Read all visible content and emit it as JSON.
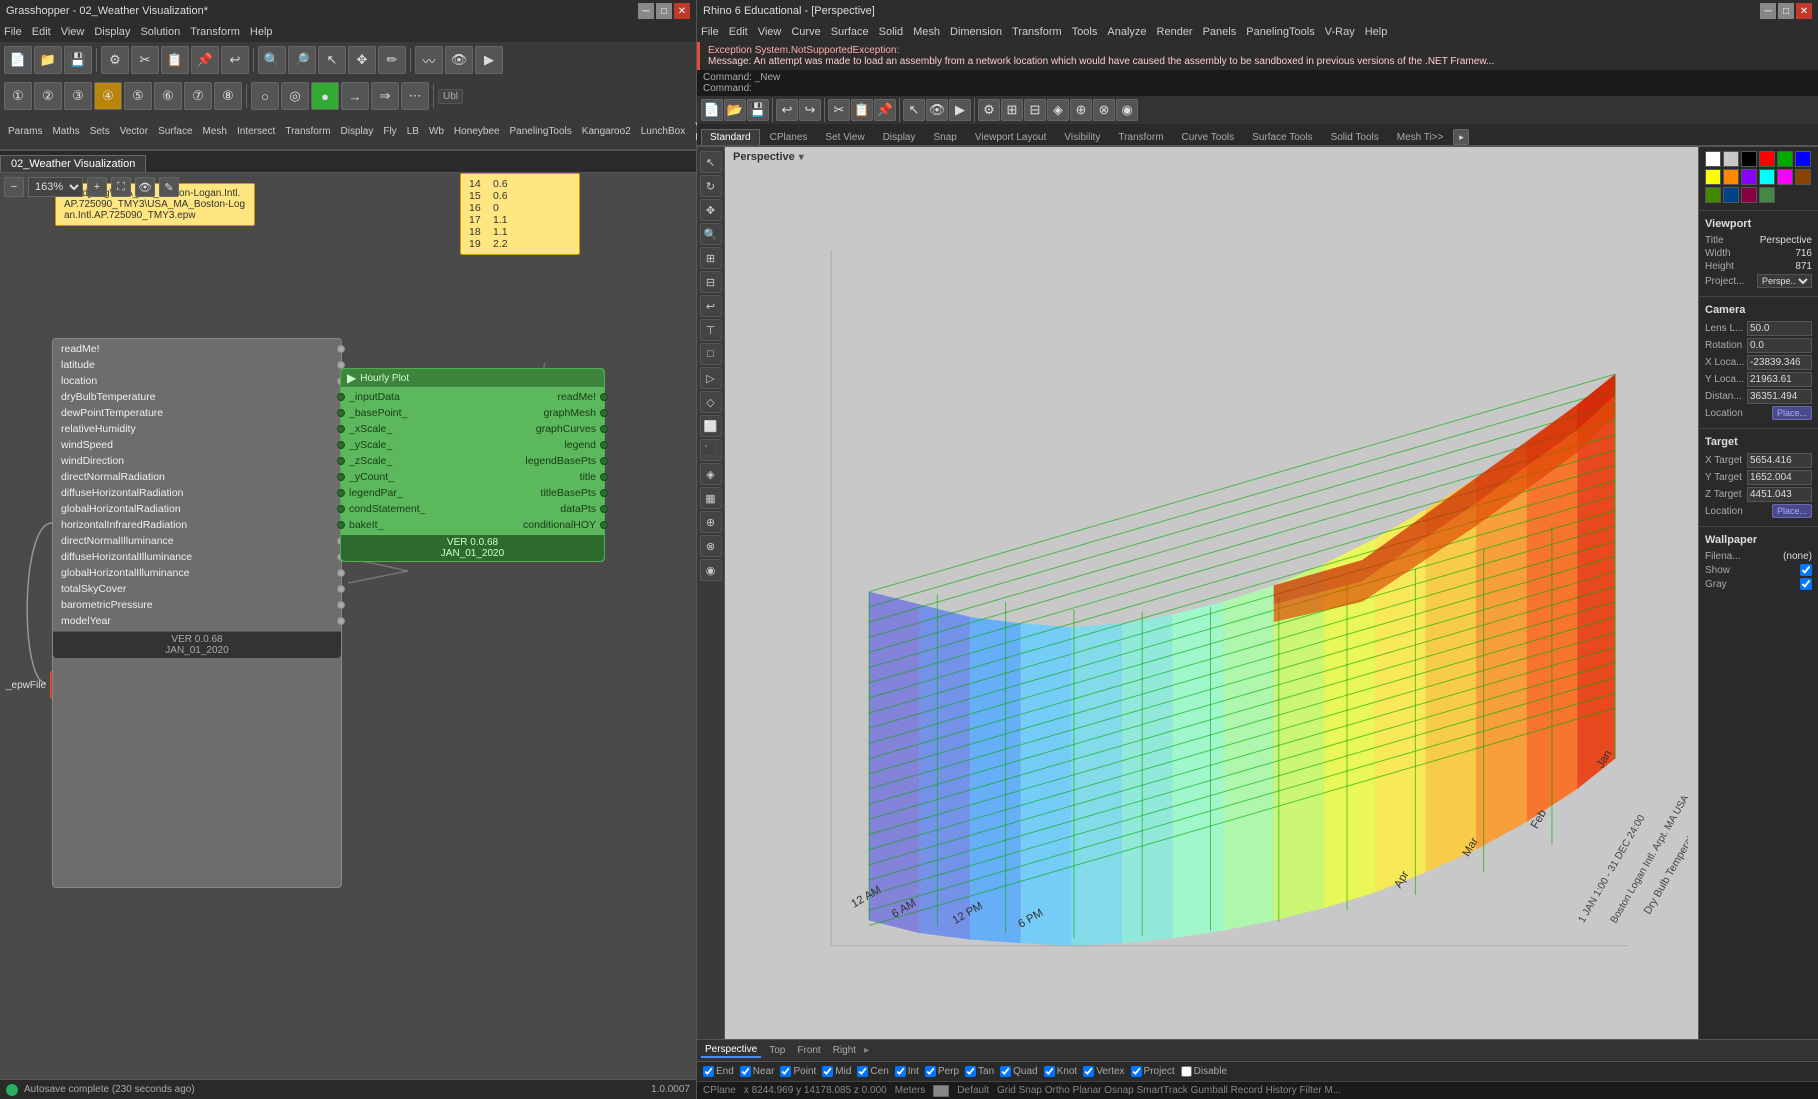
{
  "gh_title": "Grasshopper - 02_Weather Visualization*",
  "rhino_title": "Rhino 6 Educational - [Perspective]",
  "gh_menus": [
    "File",
    "Edit",
    "View",
    "Display",
    "Solution",
    "Transform",
    "Help"
  ],
  "gh_tabs_row1": [
    "Params",
    "Maths",
    "Sets",
    "Vector",
    "Surface",
    "Mesh",
    "Intersect",
    "Transform",
    "Display",
    "Fly",
    "LB",
    "Wb",
    "Honeybee",
    "PanelingTools",
    "Kangaroo2",
    "LunchBox",
    "V-Ray"
  ],
  "gh_canvas_tab": "02_Weather Visualization",
  "zoom_level": "163%",
  "note_text": "c:\\ladybug\\USA_MA_Boston-Logan.Intl.AP.725090_TMY3\\USA_MA_Boston-Logan.Intl.AP.725090_TMY3.epw",
  "num_list": [
    {
      "idx": "14",
      "val": "0.6"
    },
    {
      "idx": "15",
      "val": "0.6"
    },
    {
      "idx": "16",
      "val": "0"
    },
    {
      "idx": "17",
      "val": "1.1"
    },
    {
      "idx": "18",
      "val": "1.1"
    },
    {
      "idx": "19",
      "val": "2.2"
    }
  ],
  "epw_file_label": "_epwFile",
  "gray_node": {
    "outputs": [
      "readMe!",
      "latitude",
      "location",
      "dryBulbTemperature",
      "dewPointTemperature",
      "relativeHumidity",
      "windSpeed",
      "windDirection",
      "directNormalRadiation",
      "diffuseHorizontalRadiation",
      "globalHorizontalRadiation",
      "horizontalInfraredRadiation",
      "directNormalIlluminance",
      "diffuseHorizontalIlluminance",
      "globalHorizontalIlluminance",
      "totalSkyCover",
      "barometricPressure",
      "modelYear"
    ],
    "version": "VER 0.0.68",
    "date": "JAN_01_2020"
  },
  "green_node": {
    "inputs": [
      "_inputData",
      "_basePoint_",
      "_xScale_",
      "_yScale_",
      "_zScale_",
      "_yCount_",
      "legendPar_",
      "condStatement_",
      "bakeIt_"
    ],
    "outputs": [
      "readMe!",
      "graphMesh",
      "graphCurves",
      "legend",
      "legendBasePts",
      "title",
      "titleBasePts",
      "dataPts",
      "conditionalHOY"
    ],
    "version": "VER 0.0.68",
    "date": "JAN_01_2020"
  },
  "gh_status": "Autosave complete (230 seconds ago)",
  "gh_zoom_right": "1.0.0007",
  "rhino_menus": [
    "File",
    "Edit",
    "View",
    "Curve",
    "Surface",
    "Solid",
    "Mesh",
    "Dimension",
    "Transform",
    "Tools",
    "Analyze",
    "Render",
    "Panels",
    "PanelingTools",
    "V-Ray",
    "Help"
  ],
  "error_title": "Exception System.NotSupportedException:",
  "error_msg": "Message: An attempt was made to load an assembly from a network location which would have caused the assembly to be sandboxed in previous versions of the .NET Framew...",
  "command_new": "Command: _New",
  "command_blank": "Command:",
  "rhino_tab_strip": [
    "Standard",
    "CPlanes",
    "Set View",
    "Display",
    "Snap",
    "Viewport Layout",
    "Visibility",
    "Transform",
    "Curve Tools",
    "Surface Tools",
    "Solid Tools",
    "Mesh Ti>>"
  ],
  "viewport_label": "Perspective",
  "viewport_tabs": [
    "Perspective",
    "Top",
    "Front",
    "Right"
  ],
  "props": {
    "viewport_section": "Viewport",
    "title_label": "Title",
    "title_value": "Perspective",
    "width_label": "Width",
    "width_value": "716",
    "height_label": "Height",
    "height_value": "871",
    "projection_label": "Project...",
    "projection_value": "Perspe...",
    "camera_section": "Camera",
    "lens_label": "Lens L...",
    "lens_value": "50.0",
    "rotation_label": "Rotation",
    "rotation_value": "0.0",
    "xloca_label": "X Loca...",
    "xloca_value": "-23839.346",
    "yloca_label": "Y Loca...",
    "yloca_value": "21963.61",
    "distance_label": "Distan...",
    "distance_value": "36351.494",
    "location_label": "Location",
    "location_btn": "Place...",
    "target_section": "Target",
    "xtarget_label": "X Target",
    "xtarget_value": "5654.416",
    "ytarget_label": "Y Target",
    "ytarget_value": "1652.004",
    "ztarget_label": "Z Target",
    "ztarget_value": "4451.043",
    "target_location_label": "Location",
    "target_location_btn": "Place...",
    "wallpaper_section": "Wallpaper",
    "filename_label": "Filena...",
    "filename_value": "(none)",
    "show_label": "Show",
    "gray_label": "Gray"
  },
  "color_swatches": [
    "#ffffff",
    "#c8c8c8",
    "#000000",
    "#ff0000",
    "#00aa00",
    "#0000ff",
    "#ffff00",
    "#ff8800",
    "#8800ff",
    "#00ffff",
    "#ff00ff",
    "#884400",
    "#448800",
    "#004488",
    "#880044",
    "#448844"
  ],
  "snap_items": [
    "End",
    "Near",
    "Point",
    "Mid",
    "Cen",
    "Int",
    "Perp",
    "Tan",
    "Quad",
    "Knot",
    "Vertex",
    "Project",
    "Disable"
  ],
  "snap_checked": [
    "End",
    "Near",
    "Point",
    "Mid",
    "Cen",
    "Int",
    "Perp",
    "Tan",
    "Quad",
    "Knot",
    "Vertex",
    "Project"
  ],
  "status_cplane": "CPlane",
  "status_coords": "x 8244.969  y 14178.085  z 0.000",
  "status_units": "Meters",
  "status_layer": "Default",
  "status_snap": "Grid Snap  Ortho  Planar  Osnap  SmartTrack  Gumball  Record History  Filter  M..."
}
